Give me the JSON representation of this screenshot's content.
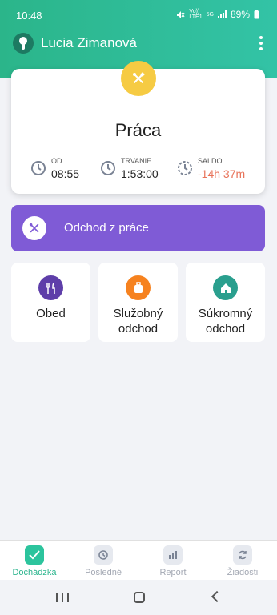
{
  "status_bar": {
    "time": "10:48",
    "volte": "Vo))",
    "lte": "LTE1",
    "net": "5G",
    "battery": "89%"
  },
  "header": {
    "user_name": "Lucia Zimanová",
    "menu_icon": "more-vertical-icon"
  },
  "work_card": {
    "title": "Práca",
    "badge_icon": "tools-icon",
    "stats": [
      {
        "label": "OD",
        "value": "08:55",
        "icon": "clock-icon"
      },
      {
        "label": "TRVANIE",
        "value": "1:53:00",
        "icon": "clock-icon"
      },
      {
        "label": "SALDO",
        "value": "-14h 37m",
        "icon": "clock-dashed-icon"
      }
    ]
  },
  "leave_button": {
    "label": "Odchod z práce",
    "icon": "tools-icon"
  },
  "tiles": [
    {
      "label": "Obed",
      "icon": "cutlery-icon",
      "color": "#5e3ea9"
    },
    {
      "label": "Služobný odchod",
      "icon": "suitcase-icon",
      "color": "#f6821f"
    },
    {
      "label": "Súkromný odchod",
      "icon": "house-icon",
      "color": "#2a9f8e"
    }
  ],
  "bottom_nav": [
    {
      "label": "Dochádzka",
      "icon": "check-icon",
      "active": true
    },
    {
      "label": "Posledné",
      "icon": "history-icon",
      "active": false
    },
    {
      "label": "Report",
      "icon": "bar-chart-icon",
      "active": false
    },
    {
      "label": "Žiadosti",
      "icon": "refresh-icon",
      "active": false
    }
  ],
  "colors": {
    "brand_green": "#2bb58a",
    "accent_purple": "#7f5bd6",
    "badge_yellow": "#f6cb43",
    "negative_red": "#e8735a"
  }
}
